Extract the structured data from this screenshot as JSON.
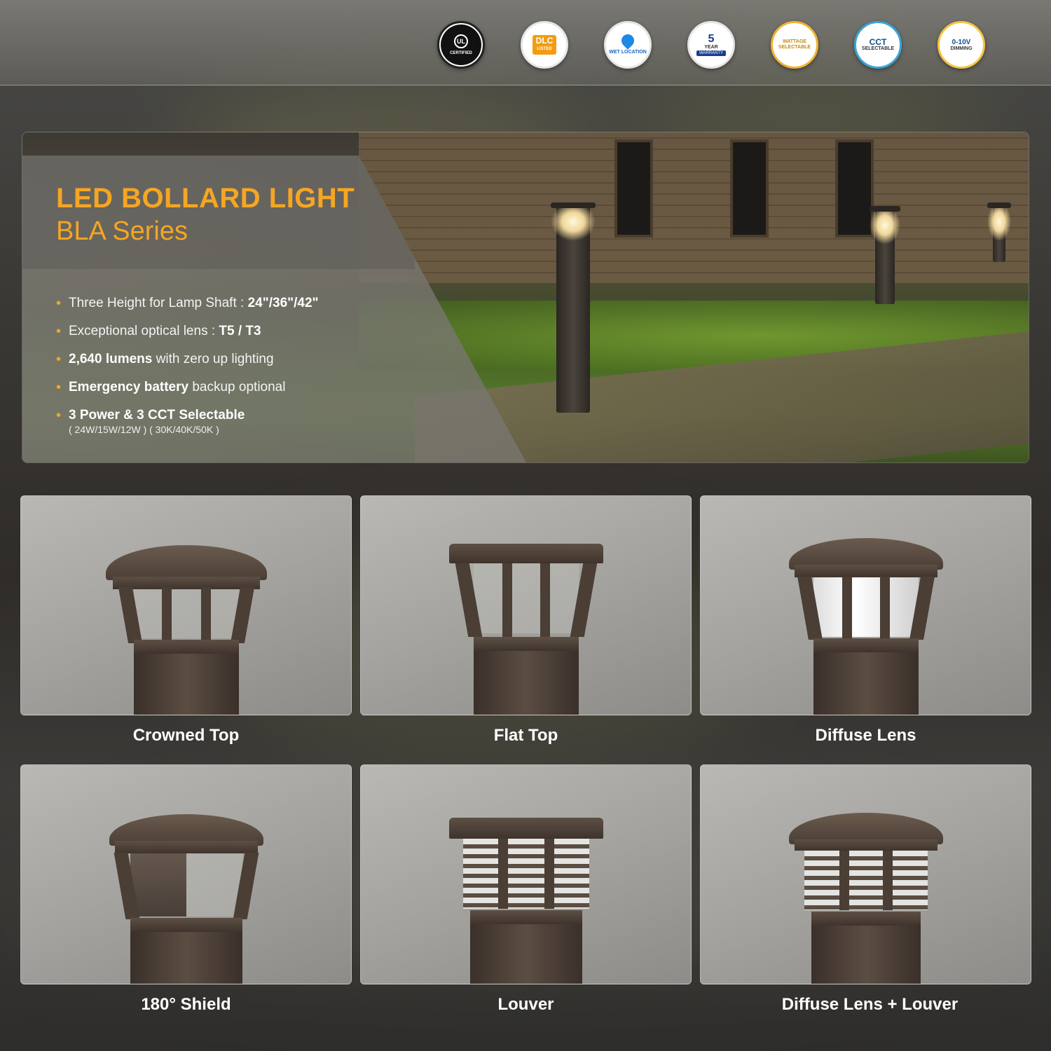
{
  "badges": [
    {
      "icon": "ul-certified-icon",
      "text": "CERTIFIED",
      "mark": "UL"
    },
    {
      "icon": "dlc-listed-icon",
      "text": "LISTED",
      "mark": "DLC"
    },
    {
      "icon": "wet-location-icon",
      "text": "WET LOCATION"
    },
    {
      "icon": "warranty-icon",
      "text": "WARRANTY",
      "mark": "5",
      "sub": "YEAR"
    },
    {
      "icon": "wattage-selectable-icon",
      "text": "WATTAGE SELECTABLE"
    },
    {
      "icon": "cct-selectable-icon",
      "text": "SELECTABLE",
      "mark": "CCT"
    },
    {
      "icon": "dimming-icon",
      "text": "DIMMING",
      "mark": "0-10V"
    }
  ],
  "hero": {
    "title": "LED BOLLARD LIGHT",
    "subtitle": "BLA Series",
    "features": [
      {
        "plain": "Three Height for Lamp Shaft : ",
        "bold": "24\"/36\"/42\""
      },
      {
        "plain": "Exceptional optical lens : ",
        "bold": "T5 / T3"
      },
      {
        "bold": "2,640 lumens",
        "plain": " with zero up lighting"
      },
      {
        "bold": "Emergency battery",
        "plain": " backup optional"
      },
      {
        "bold": "3 Power & 3 CCT Selectable",
        "sub": "( 24W/15W/12W ) ( 30K/40K/50K )"
      }
    ]
  },
  "products": [
    {
      "label": "Crowned Top"
    },
    {
      "label": "Flat Top"
    },
    {
      "label": "Diffuse Lens"
    },
    {
      "label": "180° Shield"
    },
    {
      "label": "Louver"
    },
    {
      "label": "Diffuse Lens + Louver"
    }
  ],
  "colors": {
    "accent": "#f5a623",
    "fixture": "#4a3e35"
  }
}
